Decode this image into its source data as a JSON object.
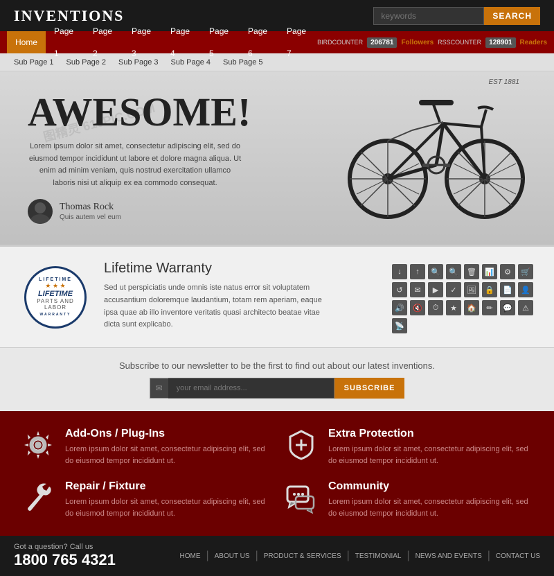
{
  "header": {
    "logo": "INVENTIONS",
    "search_placeholder": "keywords",
    "search_button": "SEARCH"
  },
  "main_nav": {
    "links": [
      "Home",
      "Page 1",
      "Page 2",
      "Page 3",
      "Page 4",
      "Page 5",
      "Page 6",
      "Page 7"
    ],
    "active": "Home",
    "birdcounter_label": "BIRDCOUNTER",
    "birdcounter_val": "206781",
    "followers_label": "Followers",
    "rsscounter_label": "RSSCOUNTER",
    "rsscounter_val": "128901",
    "readers_label": "Readers"
  },
  "sub_nav": {
    "links": [
      "Sub Page 1",
      "Sub Page 2",
      "Sub Page 3",
      "Sub Page 4",
      "Sub Page 5"
    ]
  },
  "hero": {
    "headline": "AWESOME!",
    "body": "Lorem ipsum dolor sit amet, consectetur adipiscing elit, sed do eiusmod tempor incididunt ut labore et dolore magna aliqua. Ut enim ad minim veniam, quis nostrud exercitation ullamco laboris nisi ut aliquip ex ea commodo consequat.",
    "author_name": "Thomas Rock",
    "author_sub": "Quis autem vel eum",
    "est": "EST 1881"
  },
  "features": {
    "warranty_top": "LIFETIME",
    "warranty_main": "WARRANTY",
    "warranty_sub": "PARTS AND LABOR",
    "title": "Lifetime Warranty",
    "body": "Sed ut perspiciatis unde omnis iste natus error sit voluptatem accusantium doloremque laudantium, totam rem aperiam, eaque ipsa quae ab illo inventore veritatis quasi architecto beatae vitae dicta sunt explicabo."
  },
  "newsletter": {
    "text": "Subscribe to our newsletter to be the first to find out about our latest inventions.",
    "placeholder": "your email address...",
    "button": "SUBSCRIBE"
  },
  "footer_features": [
    {
      "id": "addons",
      "title": "Add-Ons / Plug-Ins",
      "body": "Lorem ipsum dolor sit amet, consectetur adipiscing elit, sed do eiusmod tempor incididunt ut.",
      "icon": "gear"
    },
    {
      "id": "protection",
      "title": "Extra Protection",
      "body": "Lorem ipsum dolor sit amet, consectetur adipiscing elit, sed do eiusmod tempor incididunt ut.",
      "icon": "shield"
    },
    {
      "id": "repair",
      "title": "Repair / Fixture",
      "body": "Lorem ipsum dolor sit amet, consectetur adipiscing elit, sed do eiusmod tempor incididunt ut.",
      "icon": "wrench"
    },
    {
      "id": "community",
      "title": "Community",
      "body": "Lorem ipsum dolor sit amet, consectetur adipiscing elit, sed do eiusmod tempor incididunt ut.",
      "icon": "chat"
    }
  ],
  "bottom_footer": {
    "call_text": "Got a question? Call us",
    "phone": "1800 765 4321",
    "links": [
      "HOME",
      "ABOUT US",
      "PRODUCT & SERVICES",
      "TESTIMONIAL",
      "NEWS AND EVENTS",
      "CONTACT US"
    ]
  }
}
